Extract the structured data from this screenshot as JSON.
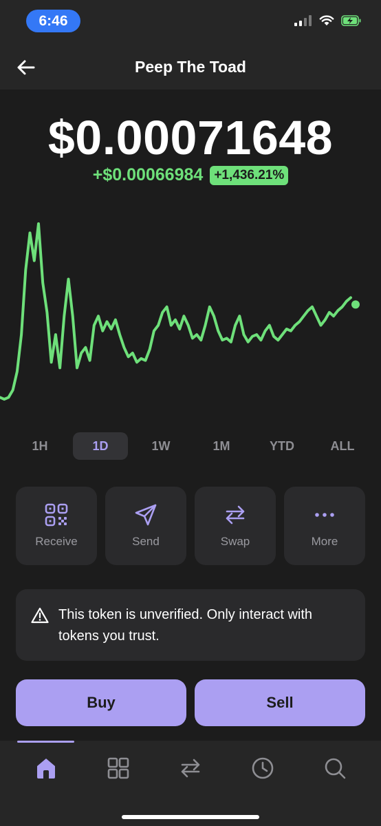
{
  "status_bar": {
    "time": "6:46"
  },
  "header": {
    "title": "Peep The Toad"
  },
  "token": {
    "price": "$0.00071648",
    "change_value": "+$0.00066984",
    "change_percent": "+1,436.21%"
  },
  "colors": {
    "accent": "#ab9ff2",
    "positive": "#6ee07a",
    "background": "#1c1c1c",
    "card": "#2a2a2c"
  },
  "chart_data": {
    "type": "line",
    "line_color": "#6ee07a",
    "x": [
      0,
      1,
      2,
      3,
      4,
      5,
      6,
      7,
      8,
      9,
      10,
      11,
      12,
      13,
      14,
      15,
      16,
      17,
      18,
      19,
      20,
      21,
      22,
      23,
      24,
      25,
      26,
      27,
      28,
      29,
      30,
      31,
      32,
      33,
      34,
      35,
      36,
      37,
      38,
      39,
      40,
      41,
      42,
      43,
      44,
      45,
      46,
      47,
      48,
      49,
      50,
      51,
      52,
      53,
      54,
      55,
      56,
      57,
      58,
      59,
      60,
      61,
      62,
      63,
      64,
      65,
      66,
      67,
      68,
      69,
      70,
      71,
      72,
      73,
      74,
      75,
      76,
      77,
      78,
      79,
      80,
      81,
      82,
      83,
      84,
      85,
      86,
      87,
      88,
      89,
      90,
      91,
      92,
      93,
      94,
      95,
      96,
      97,
      98,
      99,
      100
    ],
    "values": [
      0.06,
      0.05,
      0.06,
      0.1,
      0.2,
      0.4,
      0.75,
      0.95,
      0.8,
      1.0,
      0.68,
      0.52,
      0.25,
      0.4,
      0.22,
      0.5,
      0.7,
      0.5,
      0.22,
      0.3,
      0.33,
      0.26,
      0.45,
      0.5,
      0.42,
      0.47,
      0.43,
      0.48,
      0.4,
      0.33,
      0.28,
      0.3,
      0.25,
      0.27,
      0.26,
      0.32,
      0.42,
      0.45,
      0.52,
      0.55,
      0.45,
      0.48,
      0.43,
      0.5,
      0.45,
      0.38,
      0.4,
      0.37,
      0.45,
      0.55,
      0.5,
      0.42,
      0.37,
      0.38,
      0.36,
      0.45,
      0.5,
      0.4,
      0.36,
      0.39,
      0.4,
      0.37,
      0.42,
      0.45,
      0.39,
      0.37,
      0.4,
      0.43,
      0.42,
      0.45,
      0.47,
      0.5,
      0.53,
      0.55,
      0.5,
      0.45,
      0.48,
      0.52,
      0.5,
      0.53,
      0.55,
      0.58,
      0.6
    ],
    "title": "",
    "xlabel": "",
    "ylabel": ""
  },
  "time_ranges": {
    "selected": "1D",
    "items": [
      "1H",
      "1D",
      "1W",
      "1M",
      "YTD",
      "ALL"
    ]
  },
  "actions": [
    {
      "label": "Receive",
      "icon": "qr-code-icon"
    },
    {
      "label": "Send",
      "icon": "send-icon"
    },
    {
      "label": "Swap",
      "icon": "swap-icon"
    },
    {
      "label": "More",
      "icon": "more-icon"
    }
  ],
  "warning": {
    "icon": "warning-icon",
    "text": "This token is unverified. Only interact with tokens you trust."
  },
  "trade": {
    "buy_label": "Buy",
    "sell_label": "Sell"
  },
  "tabbar": {
    "selected": "home",
    "items": [
      "home-icon",
      "collectibles-icon",
      "swap-icon",
      "activity-icon",
      "search-icon"
    ]
  }
}
